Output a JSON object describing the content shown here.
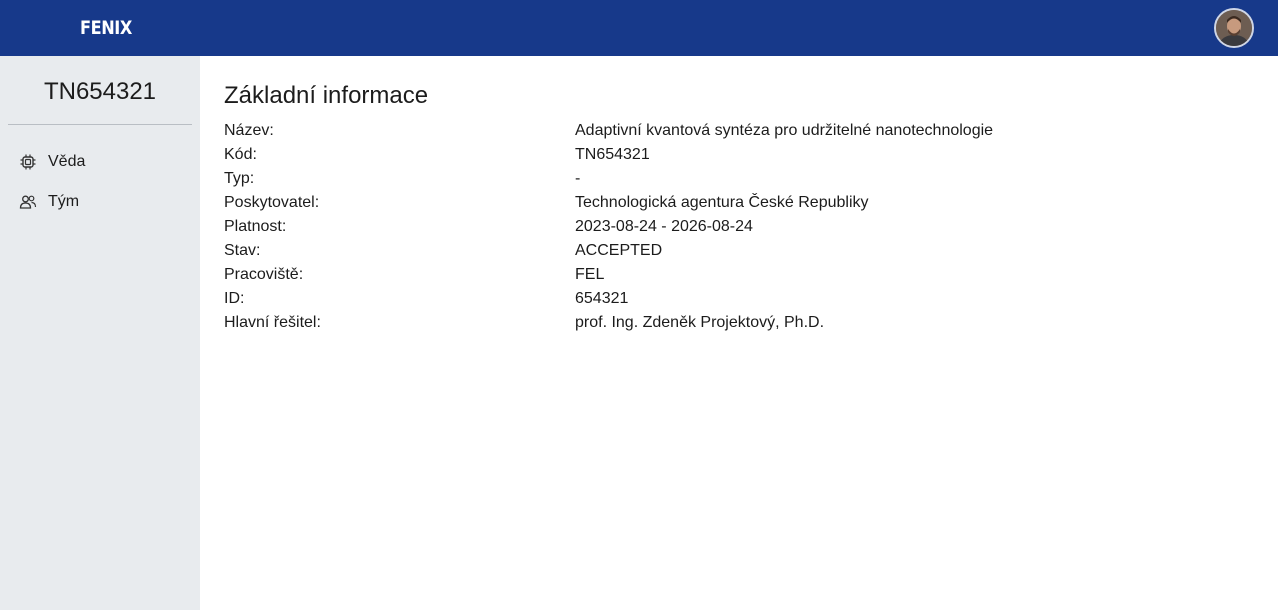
{
  "header": {
    "logo": "FENIX",
    "avatar_alt": "user-avatar"
  },
  "sidebar": {
    "project_code": "TN654321",
    "items": [
      {
        "label": "Věda",
        "icon": "chip-icon"
      },
      {
        "label": "Tým",
        "icon": "users-icon"
      }
    ]
  },
  "main": {
    "title": "Základní informace",
    "rows": [
      {
        "key": "Název:",
        "value": "Adaptivní kvantová syntéza pro udržitelné nanotechnologie"
      },
      {
        "key": "Kód:",
        "value": "TN654321"
      },
      {
        "key": "Typ:",
        "value": "-"
      },
      {
        "key": "Poskytovatel:",
        "value": "Technologická agentura České Republiky"
      },
      {
        "key": "Platnost:",
        "value": "2023-08-24 - 2026-08-24"
      },
      {
        "key": "Stav:",
        "value": "ACCEPTED"
      },
      {
        "key": "Pracoviště:",
        "value": "FEL"
      },
      {
        "key": "ID:",
        "value": "654321"
      },
      {
        "key": "Hlavní řešitel:",
        "value": "prof. Ing. Zdeněk Projektový, Ph.D."
      }
    ]
  },
  "colors": {
    "topbar": "#17398a",
    "sidebar": "#e8ebee"
  }
}
